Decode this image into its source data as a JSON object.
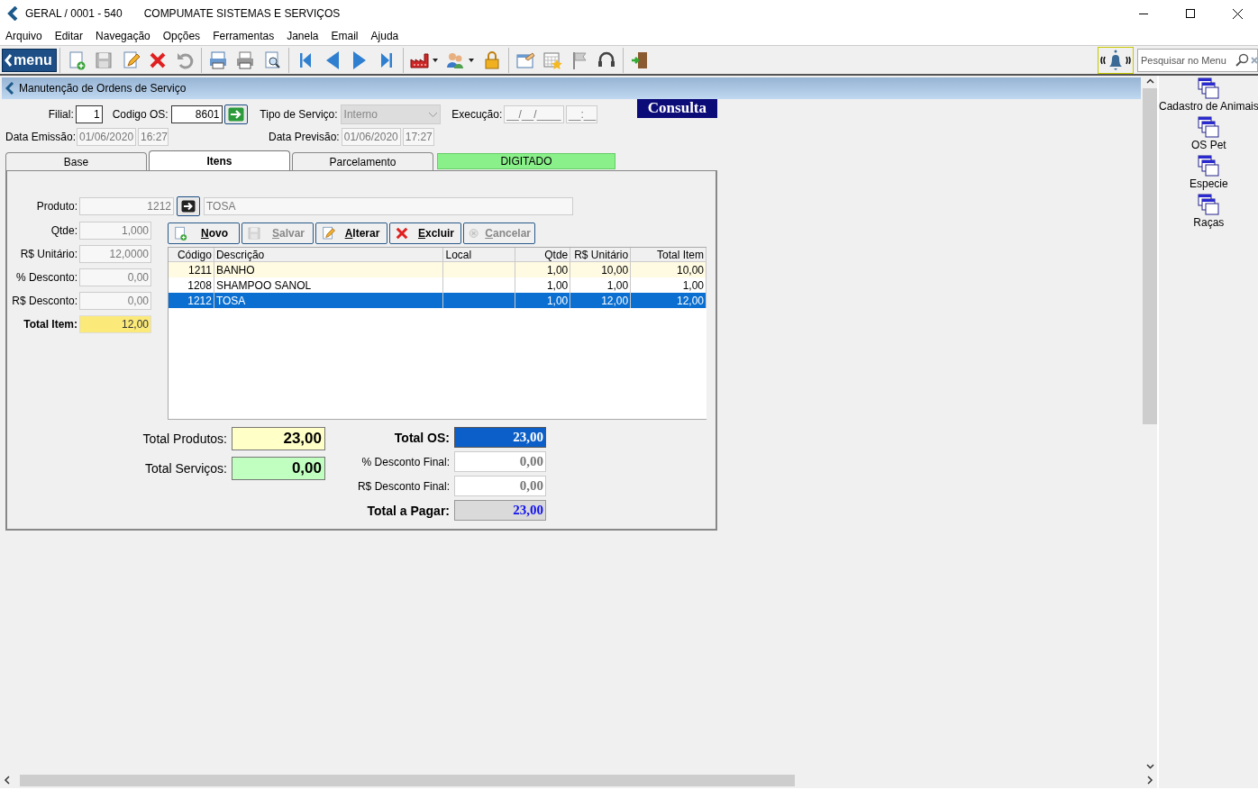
{
  "window": {
    "title": "GERAL / 0001 - 540",
    "company": "COMPUMATE SISTEMAS E SERVIÇOS"
  },
  "menu": [
    "Arquivo",
    "Editar",
    "Navegação",
    "Opções",
    "Ferramentas",
    "Janela",
    "Email",
    "Ajuda"
  ],
  "toolbar": {
    "logo": "menu",
    "groups": [
      [
        {
          "kind": "new"
        },
        {
          "kind": "save"
        },
        {
          "kind": "edit"
        },
        {
          "kind": "delete"
        },
        {
          "kind": "undo"
        }
      ],
      [
        {
          "kind": "printcolor"
        },
        {
          "kind": "print"
        },
        {
          "kind": "preview"
        }
      ],
      [
        {
          "kind": "first"
        },
        {
          "kind": "prev"
        },
        {
          "kind": "next"
        },
        {
          "kind": "last"
        }
      ],
      [
        {
          "kind": "factory"
        },
        {
          "kind": "users"
        },
        {
          "kind": "lock"
        }
      ],
      [
        {
          "kind": "folder"
        },
        {
          "kind": "calendar"
        },
        {
          "kind": "flag"
        },
        {
          "kind": "headset"
        }
      ],
      [
        {
          "kind": "exit"
        }
      ]
    ],
    "search": {
      "placeholder": "Pesquisar no Menu"
    }
  },
  "form": {
    "title": "Manutenção de Ordens de Serviço",
    "mode": "Consulta",
    "filial": {
      "label": "Filial:",
      "value": "1",
      "disabled": false
    },
    "codigo_os": {
      "label": "Codigo OS:",
      "value": "8601",
      "disabled": false
    },
    "tipo_servico": {
      "label": "Tipo de Serviço:",
      "value": "Interno",
      "disabled": true
    },
    "execucao": {
      "label": "Execução:",
      "date": "__/__/____",
      "time": "__:__"
    },
    "data_emissao": {
      "label": "Data Emissão:",
      "date": "01/06/2020",
      "time": "16:27"
    },
    "data_previsao": {
      "label": "Data Previsão:",
      "date": "01/06/2020",
      "time": "17:27"
    }
  },
  "tabs": [
    {
      "label": "Base",
      "selected": false
    },
    {
      "label": "Itens",
      "selected": true
    },
    {
      "label": "Parcelamento",
      "selected": false
    }
  ],
  "status": "DIGITADO",
  "item": {
    "produto": {
      "label": "Produto:",
      "code": "1212",
      "description": "TOSA"
    },
    "fields": [
      {
        "label": "Qtde:",
        "value": "1,000",
        "kind": "plain"
      },
      {
        "label": "R$ Unitário:",
        "value": "12,0000",
        "kind": "plain"
      },
      {
        "label": "% Desconto:",
        "value": "0,00",
        "kind": "plain"
      },
      {
        "label": "R$ Desconto:",
        "value": "0,00",
        "kind": "plain"
      },
      {
        "label": "Total Item:",
        "value": "12,00",
        "kind": "total"
      }
    ]
  },
  "actions": [
    {
      "kind": "new",
      "label": "Novo",
      "disabled": false
    },
    {
      "kind": "save",
      "label": "Salvar",
      "disabled": true
    },
    {
      "kind": "edit",
      "label": "Alterar",
      "disabled": false
    },
    {
      "kind": "delete",
      "label": "Excluir",
      "disabled": false
    },
    {
      "kind": "cancel",
      "label": "Cancelar",
      "disabled": true
    }
  ],
  "table": {
    "columns": [
      "Código",
      "Descrição",
      "Local",
      "Qtde",
      "R$ Unitário",
      "Total Item"
    ],
    "rows": [
      {
        "cells": [
          "1211",
          "BANHO",
          "",
          "1,00",
          "10,00",
          "10,00"
        ],
        "selected": false,
        "highlighted": true
      },
      {
        "cells": [
          "1208",
          "SHAMPOO SANOL",
          "",
          "1,00",
          "1,00",
          "1,00"
        ],
        "selected": false,
        "highlighted": false
      },
      {
        "cells": [
          "1212",
          "TOSA",
          "",
          "1,00",
          "12,00",
          "12,00"
        ],
        "selected": true,
        "highlighted": false
      }
    ]
  },
  "totals": {
    "left": [
      {
        "kind": "products",
        "label": "Total Produtos:",
        "value": "23,00"
      },
      {
        "kind": "services",
        "label": "Total Serviços:",
        "value": "0,00"
      }
    ],
    "right": [
      {
        "kind": "total",
        "label": "Total OS:",
        "value": "23,00"
      },
      {
        "kind": "discount",
        "label": "% Desconto Final:",
        "value": "0,00"
      },
      {
        "kind": "discount",
        "label": "R$ Desconto Final:",
        "value": "0,00"
      },
      {
        "kind": "payable",
        "label": "Total a Pagar:",
        "value": "23,00"
      }
    ]
  },
  "sidebar": {
    "items": [
      "Cadastro de Animais",
      "OS Pet",
      "Especie",
      "Raças"
    ]
  }
}
